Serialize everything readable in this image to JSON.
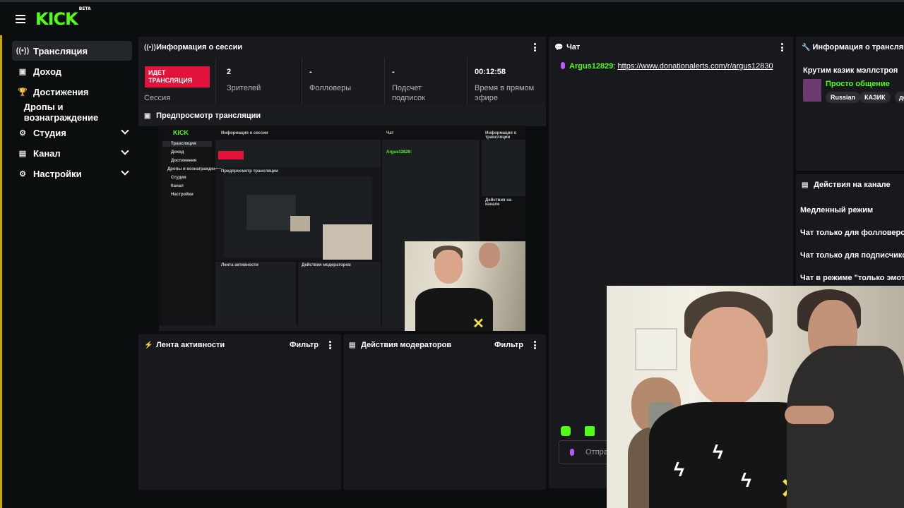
{
  "header": {
    "logo": "KICK",
    "logo_badge": "BETA"
  },
  "sidebar": {
    "items": [
      {
        "label": "Трансляция",
        "icon": "broadcast-icon",
        "active": true,
        "expandable": false
      },
      {
        "label": "Доход",
        "icon": "wallet-icon",
        "active": false,
        "expandable": false
      },
      {
        "label": "Достижения",
        "icon": "trophy-icon",
        "active": false,
        "expandable": false
      },
      {
        "label": "Дропы и вознаграждение",
        "icon": "",
        "active": false,
        "expandable": false
      },
      {
        "label": "Студия",
        "icon": "studio-icon",
        "active": false,
        "expandable": true
      },
      {
        "label": "Канал",
        "icon": "channel-icon",
        "active": false,
        "expandable": true
      },
      {
        "label": "Настройки",
        "icon": "gear-icon",
        "active": false,
        "expandable": true
      }
    ]
  },
  "session": {
    "title": "Информация о сессии",
    "live_badge": "ИДЕТ ТРАНСЛЯЦИЯ",
    "session_label": "Сессия",
    "stats": [
      {
        "value": "2",
        "label": "Зрителей"
      },
      {
        "value": "-",
        "label": "Фолловеры"
      },
      {
        "value": "-",
        "label": "Подсчет подписок"
      },
      {
        "value": "00:12:58",
        "label": "Время в прямом эфире"
      }
    ]
  },
  "preview": {
    "title": "Предпросмотр трансляции"
  },
  "activity": {
    "title": "Лента активности",
    "filter": "Фильтр"
  },
  "moderators": {
    "title": "Действия модераторов",
    "filter": "Фильтр"
  },
  "chat": {
    "title": "Чат",
    "messages": [
      {
        "user": "Argus12829",
        "text": "https://www.donationalerts.com/r/argus12830"
      }
    ],
    "input_placeholder": "Отпра"
  },
  "stream_info": {
    "title": "Информация о трансляци",
    "stream_title": "Крутим казик мэллстроя",
    "category": "Просто общение",
    "tags": [
      "Russian",
      "КАЗИК",
      "де"
    ]
  },
  "channel_actions": {
    "title": "Действия на канале",
    "items": [
      "Медленный режим",
      "Чат только для фолловеров",
      "Чат только для подписчиков",
      "Чат в режиме \"только эмоти"
    ]
  },
  "colors": {
    "brand": "#53fc18",
    "live": "#e2133a",
    "panel": "#17191c",
    "background": "#0b0e0f"
  }
}
